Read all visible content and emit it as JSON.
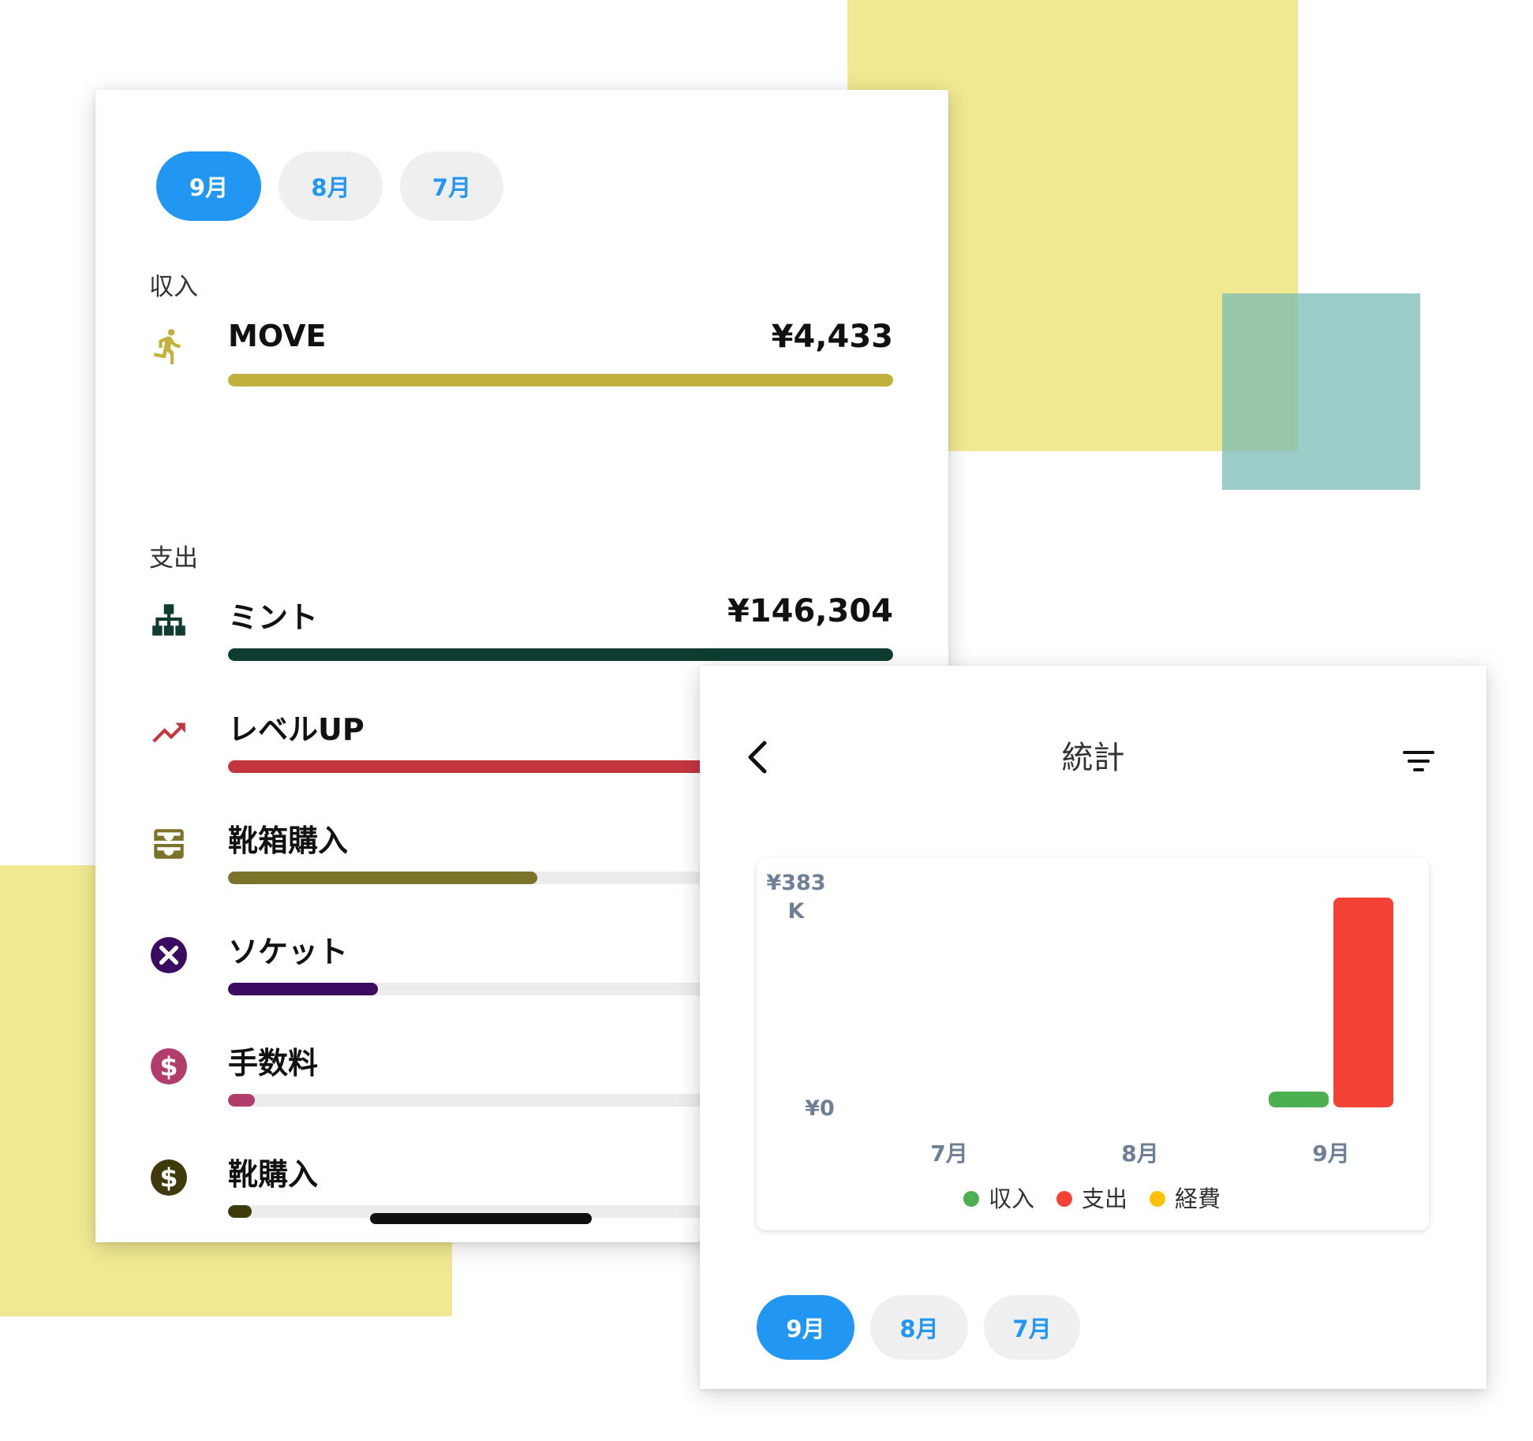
{
  "left_panel": {
    "month_tabs": [
      {
        "label": "9月",
        "active": true
      },
      {
        "label": "8月",
        "active": false
      },
      {
        "label": "7月",
        "active": false
      }
    ],
    "income_label": "収入",
    "income_items": [
      {
        "name": "MOVE",
        "amount": "¥4,433",
        "icon": "running-person-icon",
        "color": "#c1b13d",
        "progress": 1.0
      }
    ],
    "expense_label": "支出",
    "expense_items": [
      {
        "name": "ミント",
        "amount": "¥146,304",
        "icon": "sitemap-icon",
        "color": "#0f3d31",
        "progress": 1.0
      },
      {
        "name": "レベルUP",
        "amount": "",
        "icon": "trending-up-icon",
        "color": "#c4363e",
        "progress": 0.72
      },
      {
        "name": "靴箱購入",
        "amount": "",
        "icon": "inbox-tray-icon",
        "color": "#7b7329",
        "progress": 0.465
      },
      {
        "name": "ソケット",
        "amount": "",
        "icon": "close-circle-icon",
        "color": "#3b0b61",
        "progress": 0.225
      },
      {
        "name": "手数料",
        "amount": "",
        "icon": "dollar-circle-icon",
        "color": "#b23d6c",
        "progress": 0.04
      },
      {
        "name": "靴購入",
        "amount": "",
        "icon": "dollar-circle-icon",
        "color": "#3e3a0c",
        "progress": 0.035
      }
    ]
  },
  "right_panel": {
    "title": "統計",
    "month_tabs": [
      {
        "label": "9月",
        "active": true
      },
      {
        "label": "8月",
        "active": false
      },
      {
        "label": "7月",
        "active": false
      }
    ]
  },
  "chart_data": {
    "type": "bar",
    "categories": [
      "7月",
      "8月",
      "9月"
    ],
    "series": [
      {
        "name": "収入",
        "color": "#4caf50",
        "values": [
          0,
          0,
          4433
        ]
      },
      {
        "name": "支出",
        "color": "#f44336",
        "values": [
          0,
          0,
          383000
        ]
      },
      {
        "name": "経費",
        "color": "#ffc107",
        "values": [
          0,
          0,
          0
        ]
      }
    ],
    "y_max_label": "¥383 K",
    "y_min_label": "¥0",
    "ylim": [
      0,
      383000
    ],
    "legend_position": "bottom"
  }
}
